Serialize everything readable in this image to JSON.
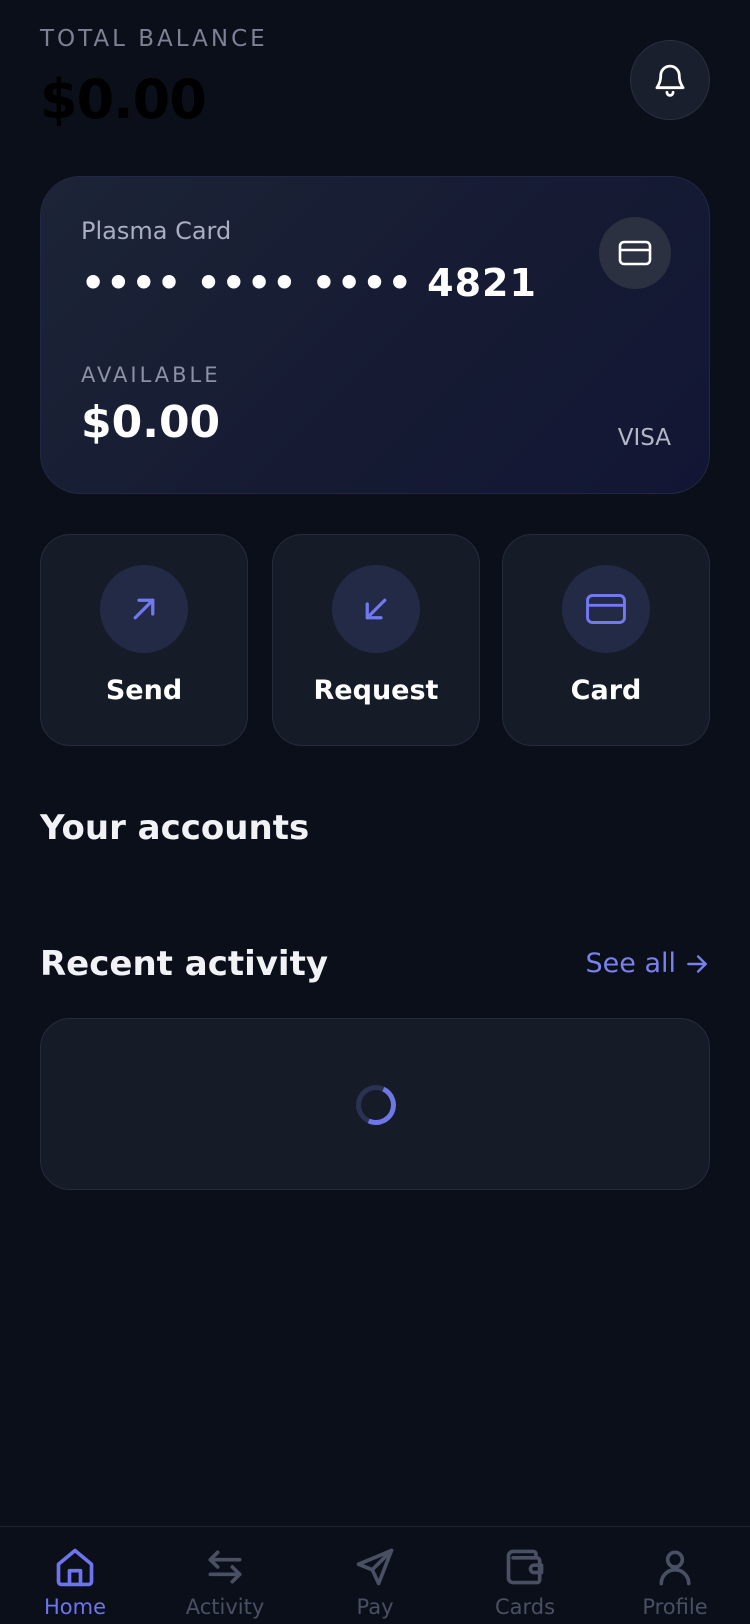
{
  "header": {
    "total_label": "TOTAL BALANCE",
    "total_amount": "$0.00"
  },
  "card": {
    "name": "Plasma Card",
    "number": "•••• •••• •••• 4821",
    "available_label": "AVAILABLE",
    "available_amount": "$0.00",
    "brand": "VISA"
  },
  "actions": [
    {
      "label": "Send",
      "icon": "arrow-up-right-icon"
    },
    {
      "label": "Request",
      "icon": "arrow-down-left-icon"
    },
    {
      "label": "Card",
      "icon": "credit-card-icon"
    }
  ],
  "sections": {
    "accounts_title": "Your accounts",
    "activity_title": "Recent activity",
    "see_all": "See all"
  },
  "nav": [
    {
      "label": "Home",
      "icon": "home-icon",
      "active": true
    },
    {
      "label": "Activity",
      "icon": "swap-arrows-icon",
      "active": false
    },
    {
      "label": "Pay",
      "icon": "paper-plane-icon",
      "active": false
    },
    {
      "label": "Cards",
      "icon": "wallet-icon",
      "active": false
    },
    {
      "label": "Profile",
      "icon": "user-icon",
      "active": false
    }
  ],
  "colors": {
    "background": "#0b0f19",
    "accent": "#6d74ee",
    "surface": "#161b28"
  }
}
